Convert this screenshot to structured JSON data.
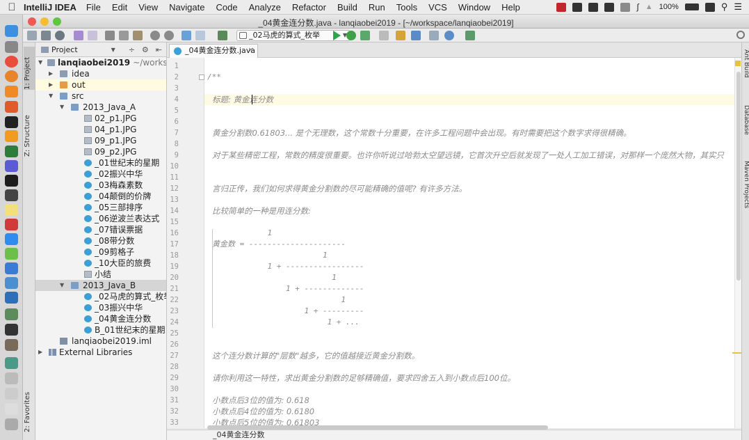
{
  "menubar": {
    "app_name": "IntelliJ IDEA",
    "items": [
      "File",
      "Edit",
      "View",
      "Navigate",
      "Code",
      "Analyze",
      "Refactor",
      "Build",
      "Run",
      "Tools",
      "VCS",
      "Window",
      "Help"
    ],
    "battery": "100%"
  },
  "window": {
    "title": "_04黄金连分数.java - lanqiaobei2019 - [~/workspace/lanqiaobei2019]"
  },
  "toolbar": {
    "run_config": "_02马虎的算式_枚举"
  },
  "left_strip": {
    "project_tab": "1: Project",
    "structure_tab": "Z: Structure",
    "favorites_tab": "2: Favorites"
  },
  "project_panel": {
    "header": "Project",
    "root_name": "lanqiaobei2019",
    "root_path": "~/worksp",
    "tree": {
      "idea": "idea",
      "out": "out",
      "src": "src",
      "java_a": "2013_Java_A",
      "a_items": [
        "02_p1.JPG",
        "04_p1.JPG",
        "09_p1.JPG",
        "09_p2.JPG",
        "_01世纪末的星期",
        "_02振兴中华",
        "_03梅森素数",
        "_04颠倒的价牌",
        "_05三部排序",
        "_06逆波兰表达式",
        "_07错误票据",
        "_08带分数",
        "_09剪格子",
        "_10大臣的旅费",
        "小结"
      ],
      "java_b": "2013_Java_B",
      "b_items": [
        "_02马虎的算式_枚举",
        "_03振兴中华",
        "_04黄金连分数",
        "B_01世纪末的星期"
      ],
      "iml": "lanqiaobei2019.iml",
      "libraries": "External Libraries"
    }
  },
  "editor": {
    "tab_label": "_04黄金连分数.java",
    "line_numbers": [
      "1",
      "2",
      "3",
      "4",
      "5",
      "6",
      "7",
      "8",
      "9",
      "10",
      "11",
      "12",
      "13",
      "14",
      "15",
      "16",
      "17",
      "18",
      "19",
      "20",
      "21",
      "22",
      "23",
      "24",
      "25",
      "26",
      "27",
      "28",
      "29",
      "30",
      "31",
      "32",
      "33"
    ],
    "lines": {
      "l2": "/**",
      "l4": "标题: 黄金连分数",
      "l7": "黄金分割数0.61803... 是个无理数，这个常数十分重要，在许多工程问题中会出现。有时需要把这个数字求得很精确。",
      "l9": "对于某些精密工程，常数的精度很重要。也许你听说过哈勃太空望远镜，它首次升空后就发现了一处人工加工错误，对那样一个庞然大物，其实只",
      "l12": "言归正传，我们如何求得黄金分割数的尽可能精确的值呢? 有许多方法。",
      "l14": "比较简单的一种是用连分数:",
      "l16": "            1",
      "l17": "黄金数 = ---------------------",
      "l18": "                        1",
      "l19": "            1 + -----------------",
      "l20": "                          1",
      "l21": "                1 + -------------",
      "l22": "                            1",
      "l23": "                    1 + ---------",
      "l24": "                         1 + ...",
      "l27": "这个连分数计算的\"层数\"越多，它的值越接近黄金分割数。",
      "l29": "请你利用这一特性，求出黄金分割数的足够精确值，要求四舍五入到小数点后100位。",
      "l31": "小数点后3位的值为: 0.618",
      "l32": "小数点后4位的值为: 0.6180",
      "l33": "小数点后5位的值为: 0.61803"
    },
    "breadcrumb": "_04黄金连分数"
  },
  "right_strip": {
    "ant": "Ant Build",
    "database": "Database",
    "maven": "Maven Projects"
  }
}
